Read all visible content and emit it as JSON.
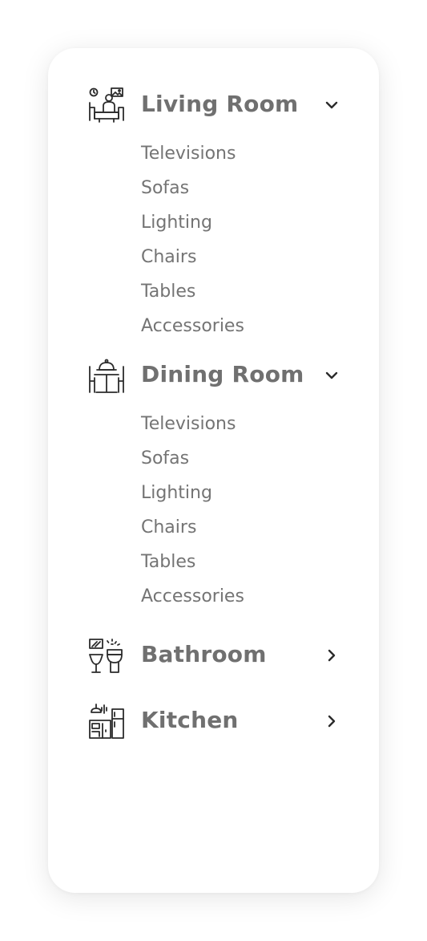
{
  "menu": {
    "categories": [
      {
        "title": "Living Room",
        "icon": "living-room-icon",
        "expanded": true,
        "items": [
          "Televisions",
          "Sofas",
          "Lighting",
          "Chairs",
          "Tables",
          "Accessories"
        ]
      },
      {
        "title": "Dining Room",
        "icon": "dining-room-icon",
        "expanded": true,
        "items": [
          "Televisions",
          "Sofas",
          "Lighting",
          "Chairs",
          "Tables",
          "Accessories"
        ]
      },
      {
        "title": "Bathroom",
        "icon": "bathroom-icon",
        "expanded": false,
        "items": []
      },
      {
        "title": "Kitchen",
        "icon": "kitchen-icon",
        "expanded": false,
        "items": []
      }
    ]
  },
  "colors": {
    "heading": "#707070",
    "item": "#747474",
    "icon": "#2b2b2b",
    "card": "#ffffff"
  }
}
